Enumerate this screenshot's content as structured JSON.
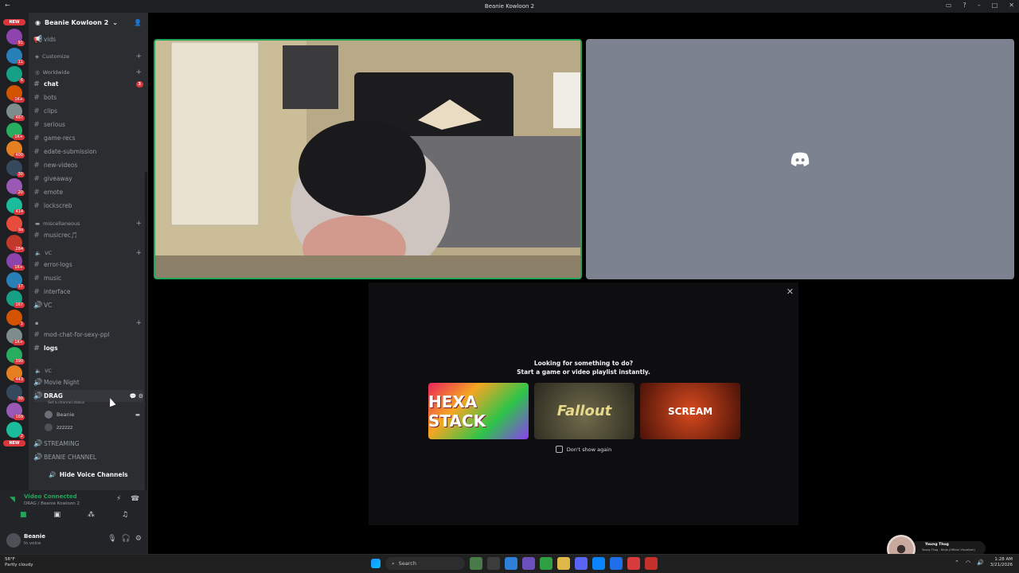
{
  "window": {
    "title": "Beanie Kowloon 2"
  },
  "server": {
    "name": "Beanie Kowloon 2"
  },
  "colors": {
    "accent": "#5865f2",
    "online": "#23a55a",
    "danger": "#da373c",
    "sidebar": "#2b2d31"
  },
  "guild_badges": [
    "NEW",
    "91",
    "11",
    "6",
    "1K+",
    "467",
    "1K+",
    "400",
    "30",
    "20",
    "414",
    "bs",
    "284",
    "1K+",
    "17",
    "167",
    "1",
    "1K+",
    "390",
    "443",
    "30",
    "169",
    "2",
    "NEW"
  ],
  "channels": {
    "vids": "vids",
    "customize": "Customize",
    "cat_worldwide": "Worldwide",
    "chat": "chat",
    "chat_mentions": "3",
    "bots": "bots",
    "clips": "clips",
    "serious": "serious",
    "game_recs": "game-recs",
    "edate": "edate-submission",
    "new_videos": "new-videos",
    "giveaway": "giveaway",
    "emote": "emote",
    "lockscreb": "lockscreb",
    "cat_misc": "miscellaneous",
    "musicrec": "musicrec🎵",
    "cat_vc": "VC",
    "error_logs": "error-logs",
    "music": "music",
    "interface": "interface",
    "vc": "VC",
    "mod_chat": "mod-chat-for-sexy-ppl",
    "logs": "logs",
    "cat_vc2": "VC",
    "movie_night": "Movie Night",
    "drag": "DRAG",
    "drag_status": "Set a channel status",
    "vc_user1": "Beanie",
    "vc_user2": "zzzzzz",
    "streaming": "STREAMING",
    "beanie_channel": "BEANIE CHANNEL",
    "hide_vc": "Hide Voice Channels"
  },
  "voice_panel": {
    "status": "Video Connected",
    "location": "DRAG / Beanie Kowloon 2"
  },
  "user_panel": {
    "name": "Beanie",
    "status": "In voice"
  },
  "activity": {
    "line1": "Looking for something to do?",
    "line2": "Start a game or video playlist instantly.",
    "games": [
      "HEXA STACK",
      "Fallout",
      "SCREAM"
    ],
    "dont_show": "Don't show again"
  },
  "taskbar": {
    "temp": "56°F",
    "weather": "Partly cloudy",
    "search_placeholder": "Search",
    "time": "1:28 AM",
    "date": "3/21/2026"
  },
  "media": {
    "title": "Young Thug",
    "subtitle": "Young Thug - Ninja (Official Visualizer)"
  }
}
